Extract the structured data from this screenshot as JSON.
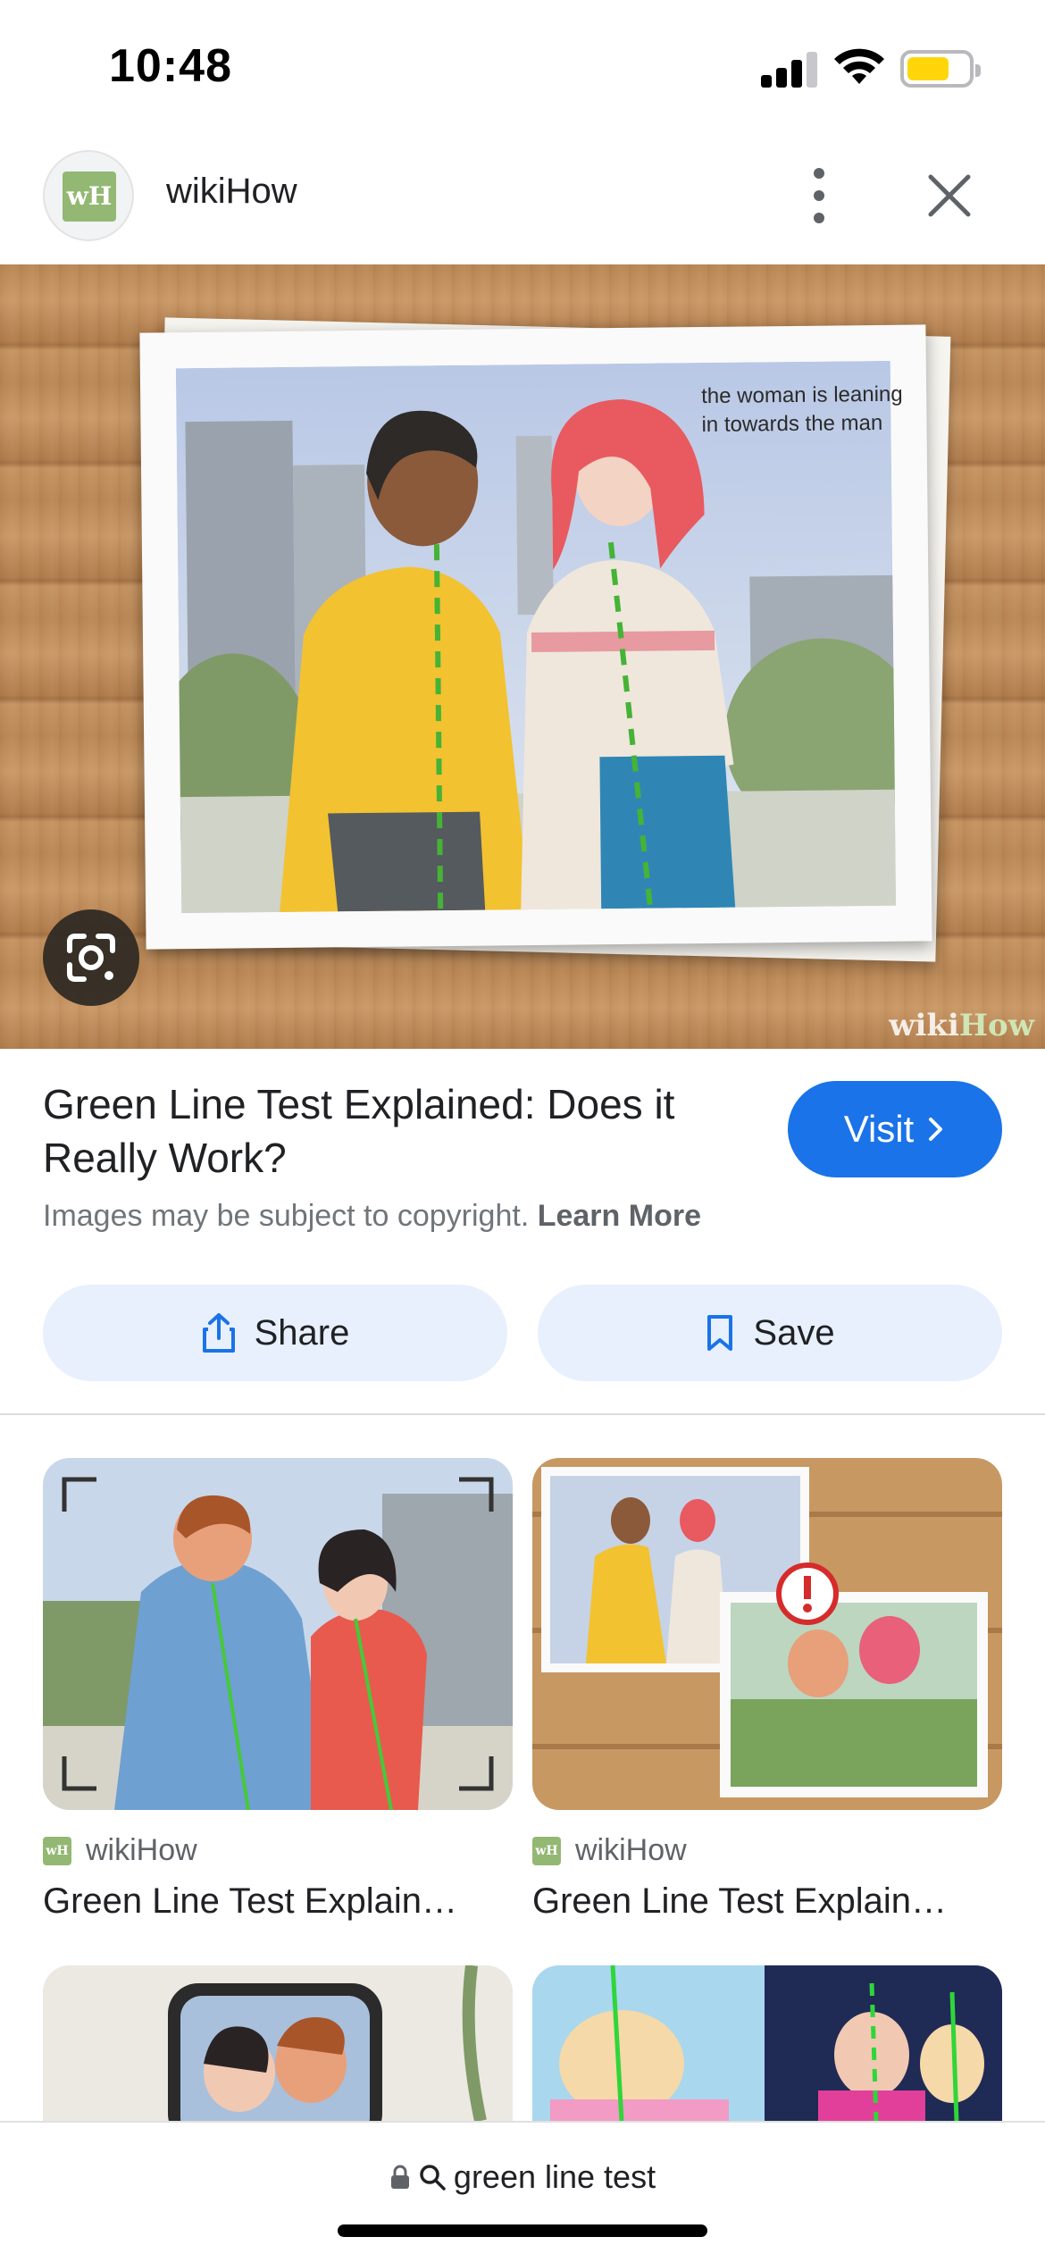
{
  "status_bar": {
    "time": "10:48",
    "signal_icon": "cellular-signal-icon",
    "wifi_icon": "wifi-icon",
    "battery_icon": "battery-icon",
    "battery_color": "#ffd60a"
  },
  "header": {
    "logo_text": "wH",
    "site_name": "wikiHow",
    "more_icon": "more-vert-icon",
    "close_icon": "close-icon"
  },
  "hero": {
    "caption": "the woman is leaning in towards the man",
    "watermark_a": "wiki",
    "watermark_b": "How",
    "lens_icon": "google-lens-icon"
  },
  "details": {
    "title": "Green Line Test Explained: Does it Really Work?",
    "visit_label": "Visit",
    "copyright_text": "Images may be subject to copyright.",
    "learn_more": "Learn More",
    "share_label": "Share",
    "save_label": "Save",
    "accent_color": "#1a73e8"
  },
  "related": [
    {
      "source": "wikiHow",
      "title": "Green Line Test Explain…",
      "logo_text": "wH"
    },
    {
      "source": "wikiHow",
      "title": "Green Line Test Explain…",
      "logo_text": "wH"
    }
  ],
  "url_bar": {
    "query": "green line test",
    "lock_icon": "lock-icon",
    "search_icon": "search-icon"
  }
}
